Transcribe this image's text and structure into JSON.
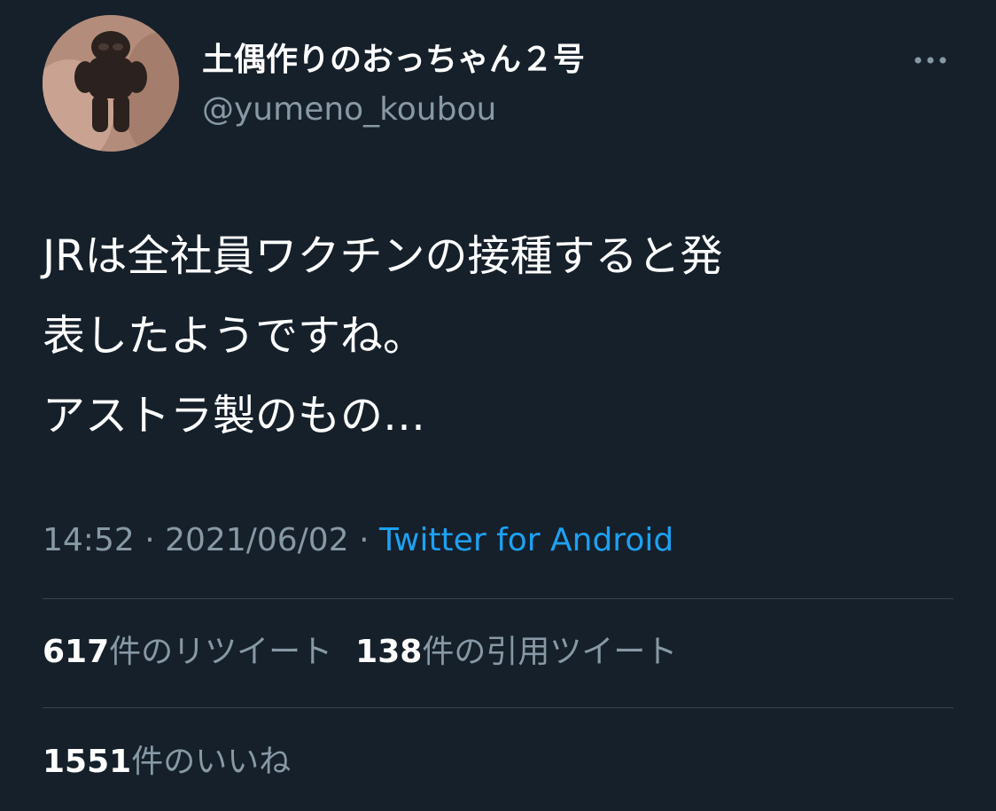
{
  "user": {
    "display_name": "土偶作りのおっちゃん２号",
    "handle": "@yumeno_koubou"
  },
  "tweet": {
    "lines": [
      "JRは全社員ワクチンの接種すると発",
      "表したようですね。",
      "アストラ製のもの…"
    ],
    "time": "14:52",
    "separator": "·",
    "date": "2021/06/02",
    "source": "Twitter for Android"
  },
  "stats": {
    "retweets_count": "617",
    "retweets_label": "件のリツイート",
    "quotes_count": "138",
    "quotes_label": "件の引用ツイート",
    "likes_count": "1551",
    "likes_label": "件のいいね"
  },
  "colors": {
    "background": "#15202b",
    "text": "#ffffff",
    "secondary": "#8899a6",
    "link": "#1da1f2",
    "divider": "#38444d"
  },
  "icons": {
    "more": "more-horizontal-icon"
  }
}
